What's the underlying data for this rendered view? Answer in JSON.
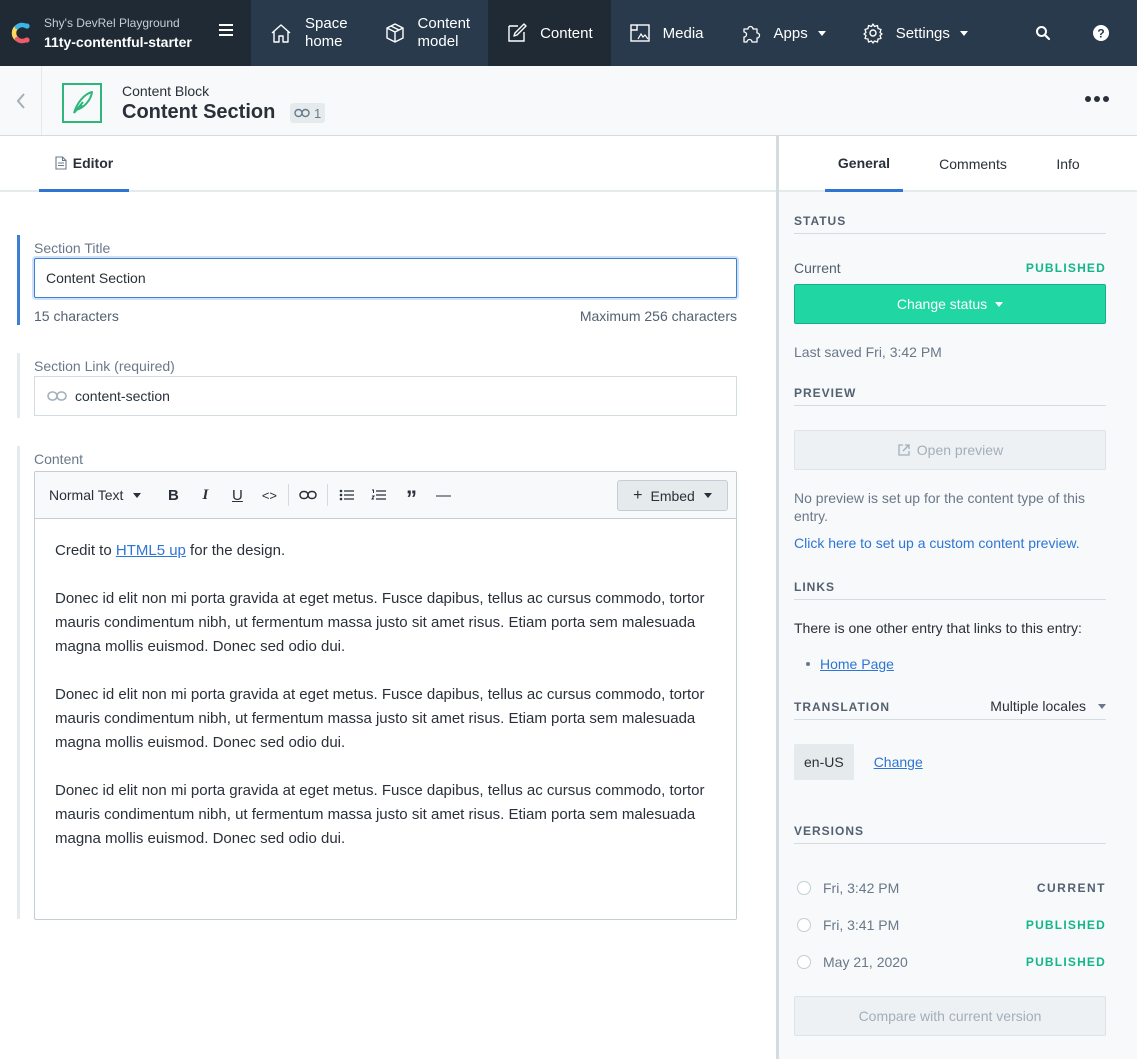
{
  "topnav": {
    "space_org": "Shy's DevRel Playground",
    "space_env": "11ty-contentful-starter",
    "items": [
      {
        "label_1": "Space",
        "label_2": "home"
      },
      {
        "label_1": "Content",
        "label_2": "model"
      },
      {
        "label": "Content"
      },
      {
        "label": "Media"
      },
      {
        "label": "Apps"
      },
      {
        "label": "Settings"
      }
    ]
  },
  "entry": {
    "content_type": "Content Block",
    "title": "Content Section",
    "ref_count": "1"
  },
  "editor": {
    "tab_label": "Editor",
    "fields": {
      "title": {
        "label": "Section Title",
        "value": "Content Section",
        "char_count": "15 characters",
        "max_chars": "Maximum 256 characters"
      },
      "slug": {
        "label": "Section Link (required)",
        "value": "content-section"
      },
      "content": {
        "label": "Content",
        "toolbar": {
          "style": "Normal Text",
          "bold": "B",
          "italic": "I",
          "underline": "U",
          "code": "<>",
          "quote": "”",
          "hr": "—",
          "embed": "Embed"
        },
        "paragraph_1_pre": "Credit to ",
        "paragraph_1_link": "HTML5 up",
        "paragraph_1_post": " for the design.",
        "paragraph_2": "Donec id elit non mi porta gravida at eget metus. Fusce dapibus, tellus ac cursus commodo, tortor mauris condimentum nibh, ut fermentum massa justo sit amet risus. Etiam porta sem malesuada magna mollis euismod. Donec sed odio dui.",
        "paragraph_3": "Donec id elit non mi porta gravida at eget metus. Fusce dapibus, tellus ac cursus commodo, tortor mauris condimentum nibh, ut fermentum massa justo sit amet risus. Etiam porta sem malesuada magna mollis euismod. Donec sed odio dui.",
        "paragraph_4": "Donec id elit non mi porta gravida at eget metus. Fusce dapibus, tellus ac cursus commodo, tortor mauris condimentum nibh, ut fermentum massa justo sit amet risus. Etiam porta sem malesuada magna mollis euismod. Donec sed odio dui."
      }
    }
  },
  "sidebar": {
    "tabs": [
      "General",
      "Comments",
      "Info"
    ],
    "status": {
      "heading": "STATUS",
      "current_label": "Current",
      "current_value": "PUBLISHED",
      "change_button": "Change status",
      "last_saved": "Last saved Fri, 3:42 PM"
    },
    "preview": {
      "heading": "PREVIEW",
      "button": "Open preview",
      "note": "No preview is set up for the content type of this entry.",
      "link": "Click here to set up a custom content preview."
    },
    "links": {
      "heading": "LINKS",
      "text": "There is one other entry that links to this entry:",
      "items": [
        "Home Page"
      ]
    },
    "translation": {
      "heading": "TRANSLATION",
      "select": "Multiple locales",
      "locale": "en-US",
      "change": "Change"
    },
    "versions": {
      "heading": "VERSIONS",
      "items": [
        {
          "date": "Fri, 3:42 PM",
          "status": "CURRENT"
        },
        {
          "date": "Fri, 3:41 PM",
          "status": "PUBLISHED"
        },
        {
          "date": "May 21, 2020",
          "status": "PUBLISHED"
        }
      ],
      "compare_button": "Compare with current version"
    }
  }
}
